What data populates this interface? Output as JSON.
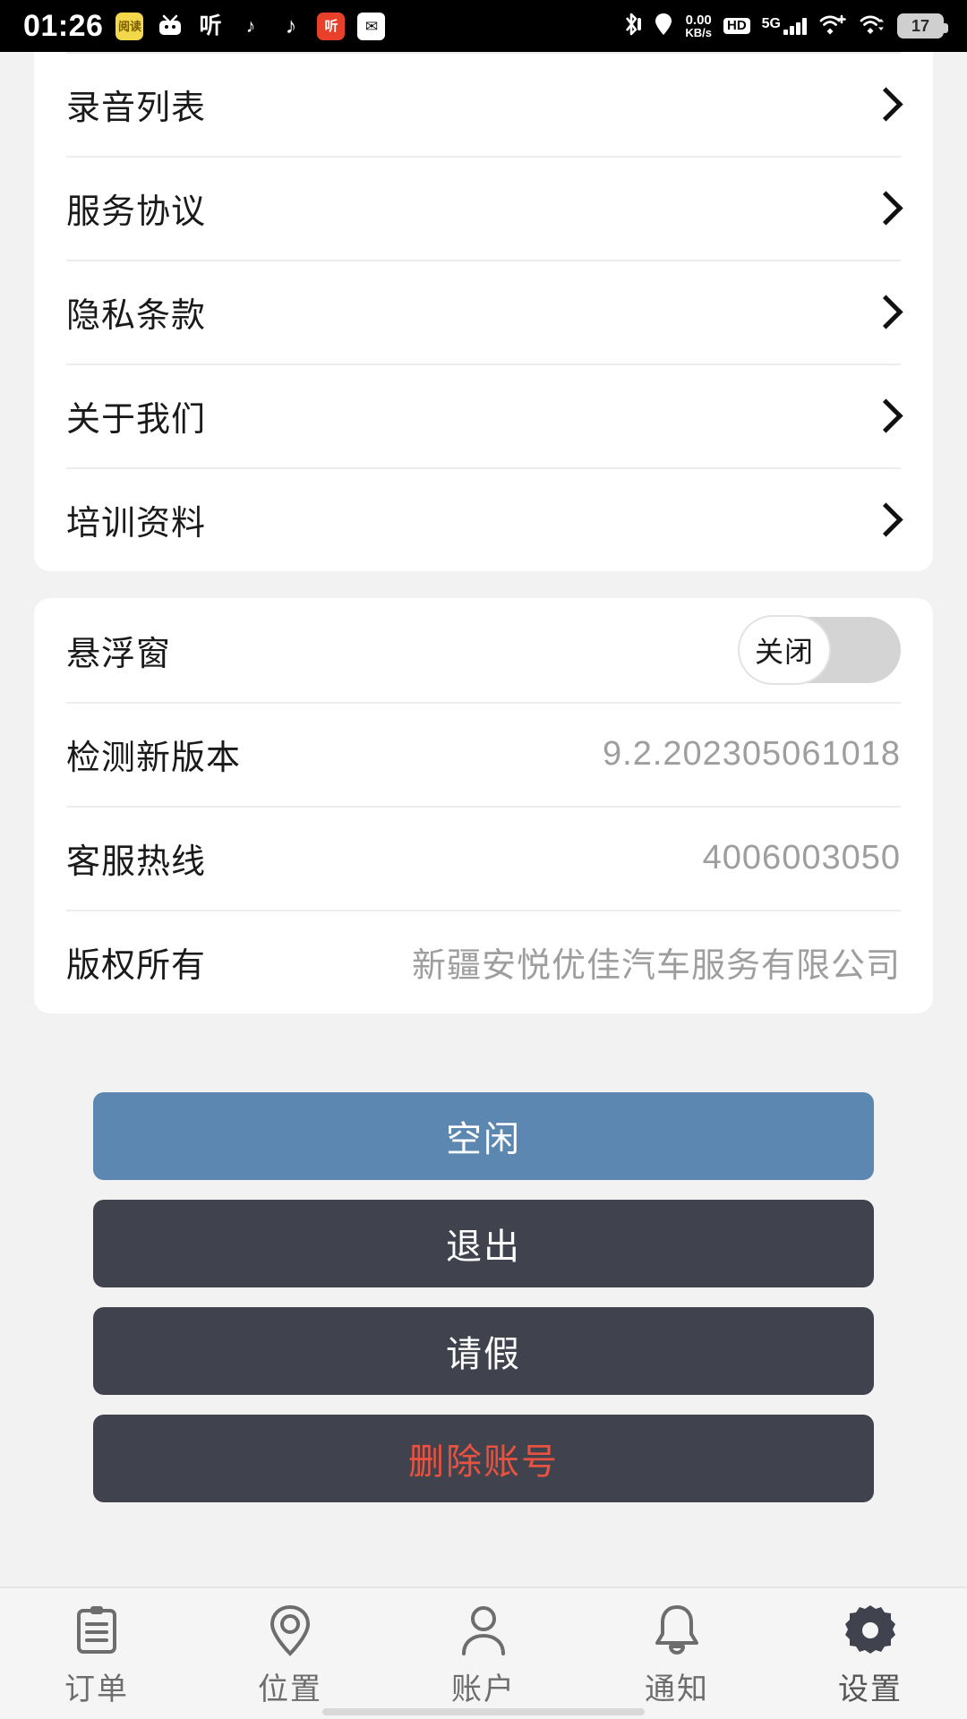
{
  "statusbar": {
    "time": "01:26",
    "app_icons": [
      {
        "name": "reading-app-icon",
        "glyph": "阅读"
      },
      {
        "name": "bilibili-icon",
        "glyph": "ᗧ"
      },
      {
        "name": "listen-app-icon",
        "glyph": "听"
      },
      {
        "name": "douyin-lite-icon",
        "glyph": "♪"
      },
      {
        "name": "tiktok-icon",
        "glyph": "♪"
      },
      {
        "name": "ximalaya-icon",
        "glyph": "听"
      },
      {
        "name": "mail-icon",
        "glyph": "✉"
      }
    ],
    "bluetooth": "bluetooth-icon",
    "location": "location-icon",
    "netspeed_value": "0.00",
    "netspeed_unit": "KB/s",
    "hd": "HD",
    "network_type": "5G",
    "wifi_plus": "wifi-plus-icon",
    "wifi_sync": "wifi-sync-icon",
    "battery": "17"
  },
  "menu_card": {
    "items": [
      {
        "label": "录音列表",
        "name": "recording-list"
      },
      {
        "label": "服务协议",
        "name": "service-agreement"
      },
      {
        "label": "隐私条款",
        "name": "privacy-policy"
      },
      {
        "label": "关于我们",
        "name": "about-us"
      },
      {
        "label": "培训资料",
        "name": "training-materials"
      }
    ]
  },
  "info_card": {
    "floating_window": {
      "label": "悬浮窗",
      "toggle_state": "关闭",
      "enabled": false
    },
    "rows": [
      {
        "label": "检测新版本",
        "value": "9.2.202305061018",
        "name": "check-new-version"
      },
      {
        "label": "客服热线",
        "value": "4006003050",
        "name": "customer-service-hotline"
      },
      {
        "label": "版权所有",
        "value": "新疆安悦优佳汽车服务有限公司",
        "name": "copyright"
      }
    ]
  },
  "actions": [
    {
      "label": "空闲",
      "name": "idle-button",
      "style": "primary"
    },
    {
      "label": "退出",
      "name": "logout-button",
      "style": "dark"
    },
    {
      "label": "请假",
      "name": "leave-request-button",
      "style": "dark"
    },
    {
      "label": "删除账号",
      "name": "delete-account-button",
      "style": "danger"
    }
  ],
  "tabbar": {
    "items": [
      {
        "label": "订单",
        "name": "tab-orders",
        "icon": "clipboard-icon",
        "active": false
      },
      {
        "label": "位置",
        "name": "tab-location",
        "icon": "map-pin-icon",
        "active": false
      },
      {
        "label": "账户",
        "name": "tab-account",
        "icon": "user-icon",
        "active": false
      },
      {
        "label": "通知",
        "name": "tab-notifications",
        "icon": "bell-icon",
        "active": false
      },
      {
        "label": "设置",
        "name": "tab-settings",
        "icon": "gear-icon",
        "active": true
      }
    ]
  },
  "colors": {
    "primary_button": "#5b87b0",
    "dark_button": "#40434d",
    "danger_text": "#e8523f",
    "page_background": "#f2f2f2",
    "card_background": "#ffffff"
  }
}
